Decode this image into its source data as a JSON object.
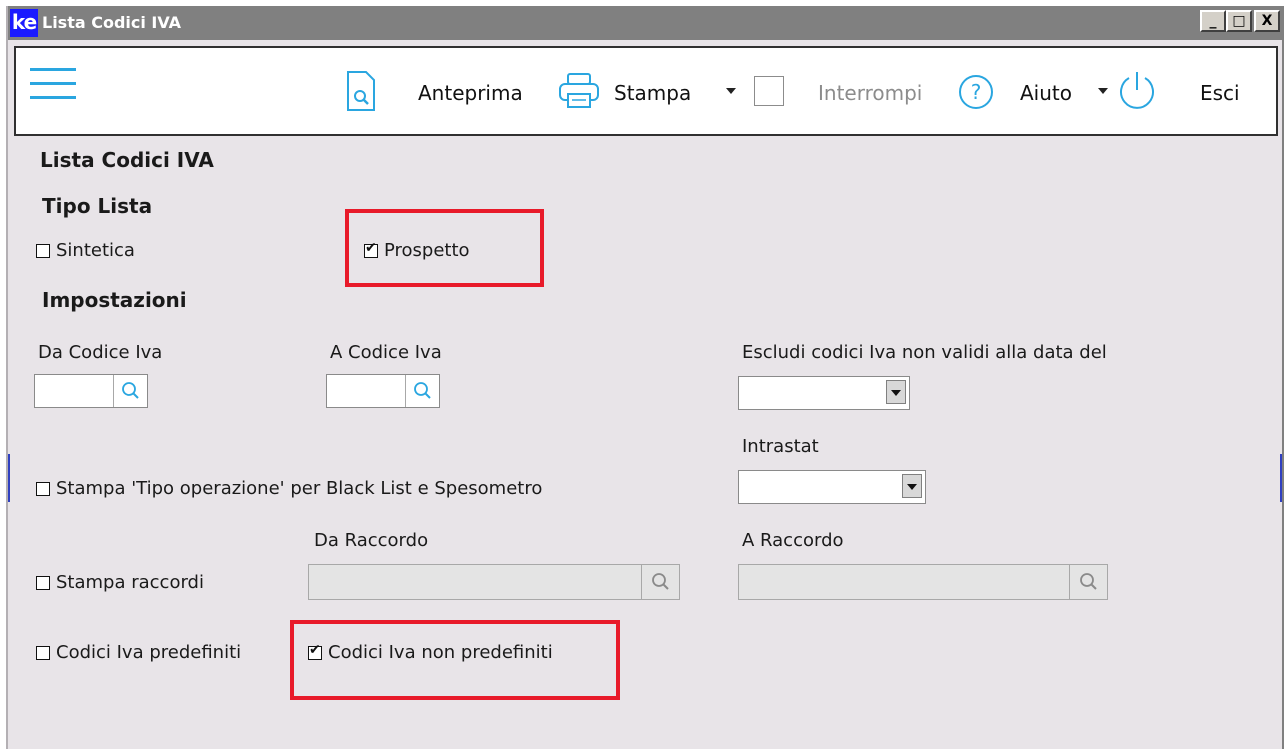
{
  "window": {
    "title": "Lista Codici IVA",
    "logo": "ke"
  },
  "window_buttons": {
    "minimize": "_",
    "maximize": "□",
    "close": "X"
  },
  "toolbar": {
    "preview_label": "Anteprima",
    "print_label": "Stampa",
    "interrupt_label": "Interrompi",
    "help_label": "Aiuto",
    "exit_label": "Esci",
    "accent_color": "#2aa6e0"
  },
  "form": {
    "title": "Lista Codici IVA",
    "list_type_heading": "Tipo Lista",
    "sintetica_label": "Sintetica",
    "sintetica_checked": false,
    "prospetto_label": "Prospetto",
    "prospetto_checked": true,
    "settings_heading": "Impostazioni",
    "from_code_label": "Da Codice Iva",
    "from_code_value": "",
    "to_code_label": "A Codice Iva",
    "to_code_value": "",
    "exclude_label": "Escludi codici Iva non validi alla data del",
    "exclude_value": "",
    "intrastat_label": "Intrastat",
    "intrastat_value": "",
    "tipo_operazione_label": "Stampa 'Tipo operazione' per Black List e Spesometro",
    "tipo_operazione_checked": false,
    "from_raccordo_label": "Da Raccordo",
    "from_raccordo_value": "",
    "to_raccordo_label": "A Raccordo",
    "to_raccordo_value": "",
    "stampa_raccordi_label": "Stampa raccordi",
    "stampa_raccordi_checked": false,
    "predefiniti_label": "Codici Iva predefiniti",
    "predefiniti_checked": false,
    "non_predefiniti_label": "Codici Iva non predefiniti",
    "non_predefiniti_checked": true
  },
  "highlight_color": "#e81a2a"
}
